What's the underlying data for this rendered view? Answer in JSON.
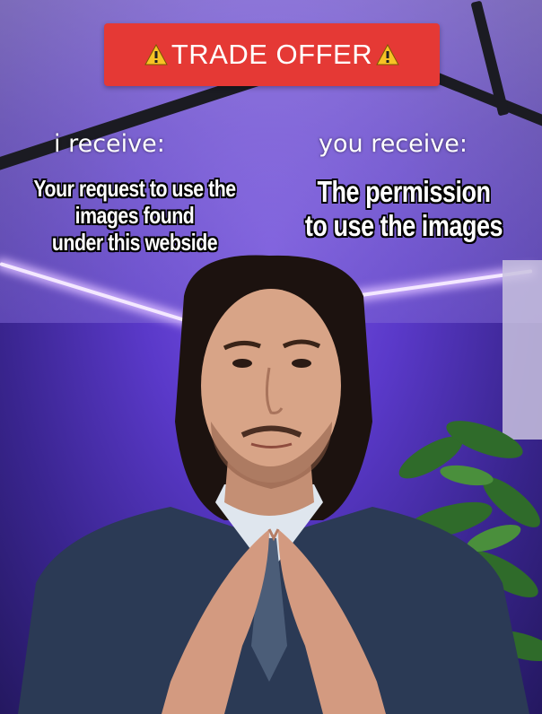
{
  "banner": {
    "text": "TRADE OFFER",
    "color": "#e53935",
    "icon": "warning-icon"
  },
  "left_column": {
    "label": "i receive:",
    "caption_lines": [
      "Your request to use the",
      "images found",
      "under this webside"
    ]
  },
  "right_column": {
    "label": "you receive:",
    "caption_lines": [
      "The permission",
      "to use the images"
    ]
  },
  "scene": {
    "lighting_color": "#6a48d8",
    "subject": "man-in-suit"
  }
}
